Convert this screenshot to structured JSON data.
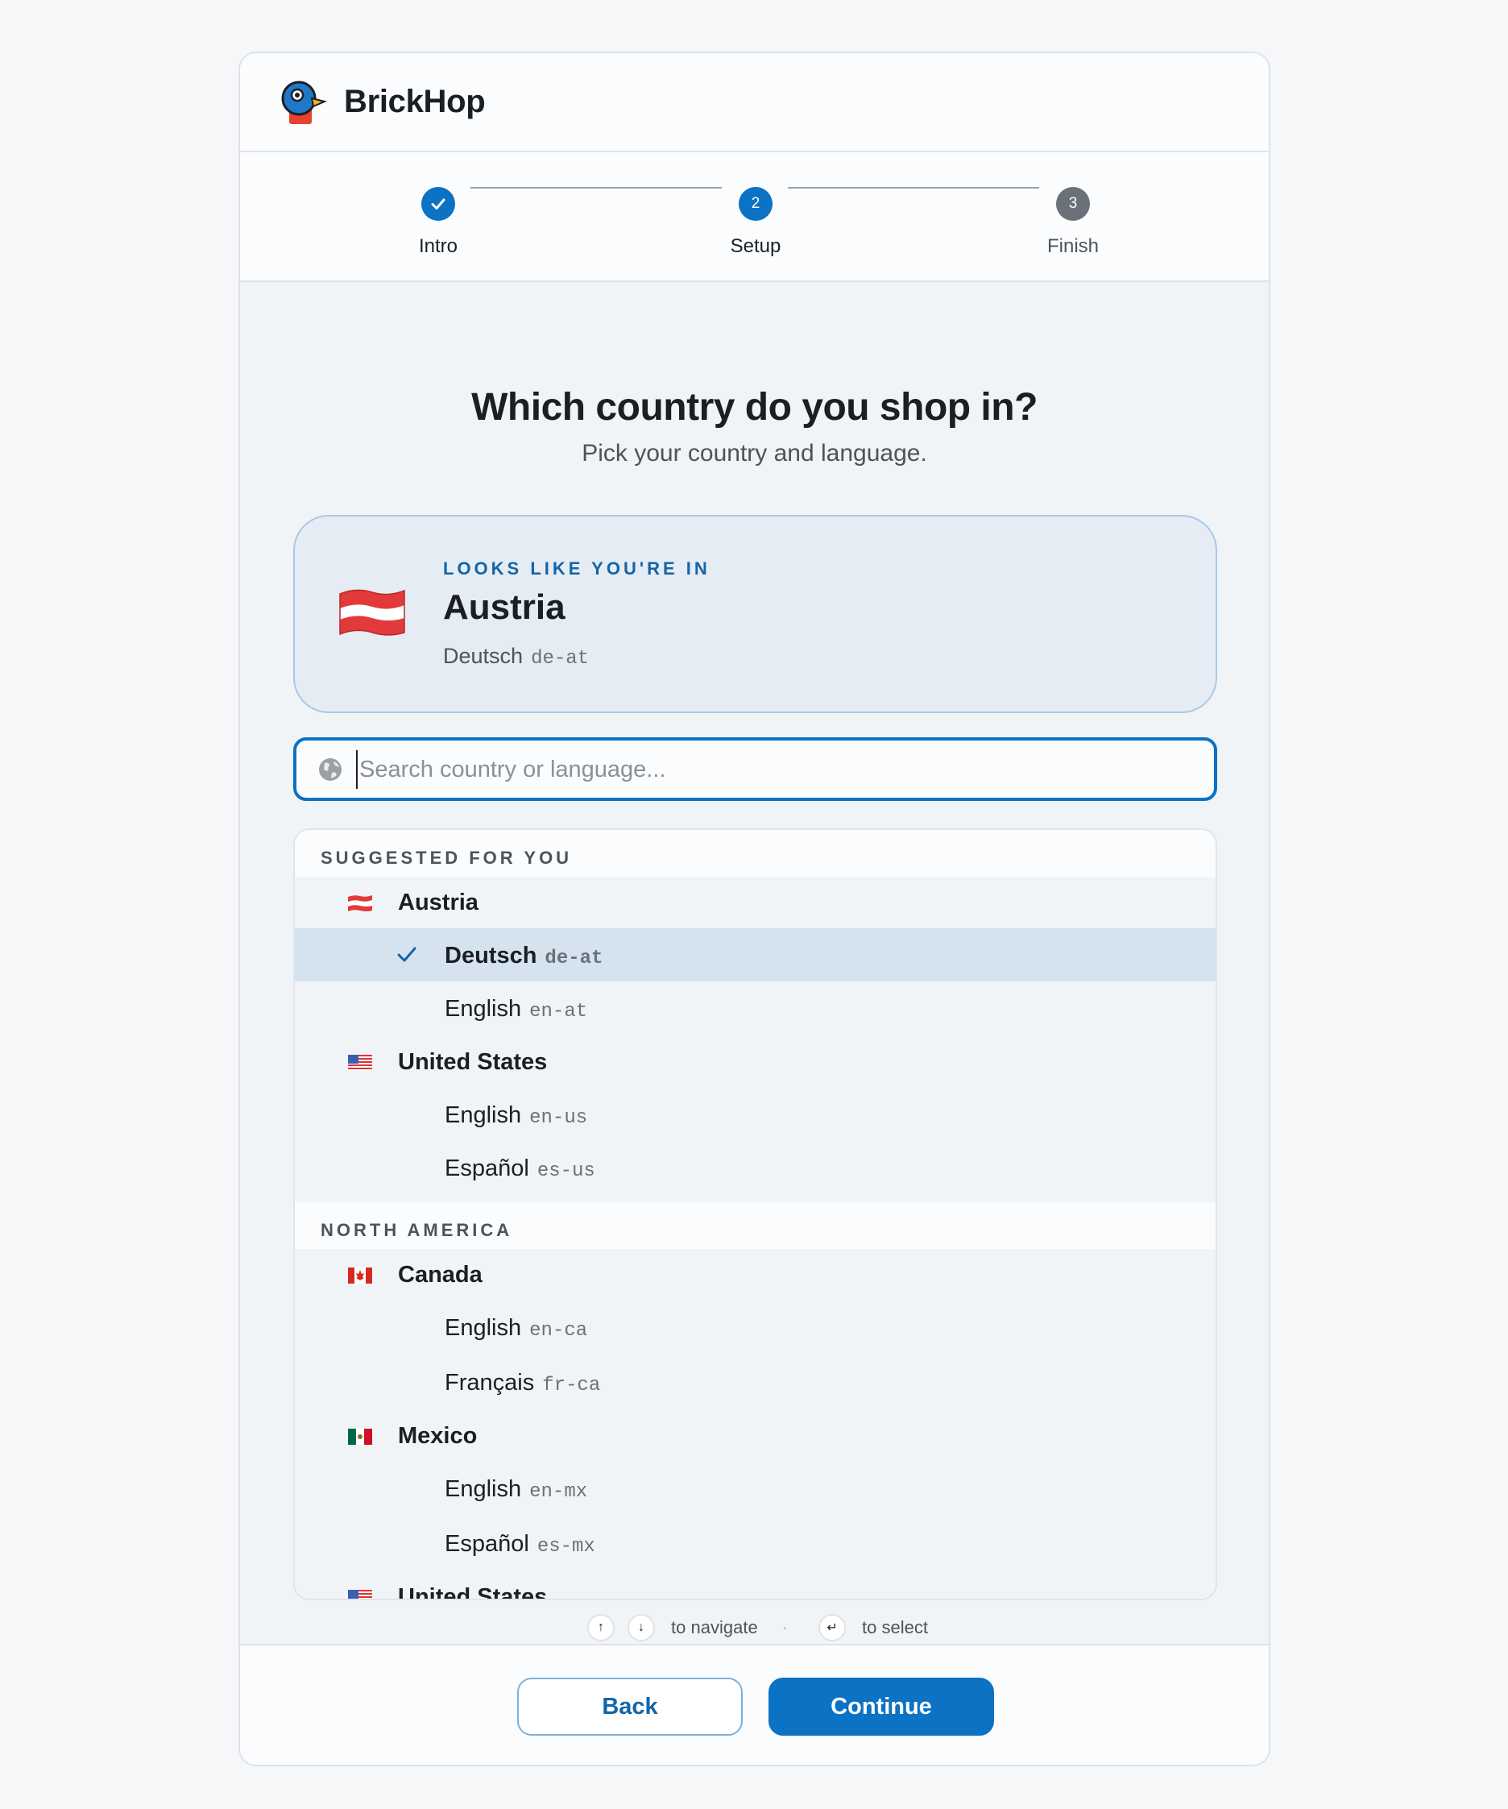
{
  "brand": {
    "name": "BrickHop",
    "logo_icon": "duck-logo-icon"
  },
  "stepper": {
    "steps": [
      {
        "label": "Intro",
        "state": "done",
        "number": "1"
      },
      {
        "label": "Setup",
        "state": "active",
        "number": "2"
      },
      {
        "label": "Finish",
        "state": "todo",
        "number": "3"
      }
    ]
  },
  "page": {
    "title": "Which country do you shop in?",
    "subtitle": "Pick your country and language."
  },
  "detected": {
    "kicker": "LOOKS LIKE YOU'RE IN",
    "country": "Austria",
    "language": "Deutsch",
    "code": "de-at",
    "flag_icon": "austria-flag-icon"
  },
  "search": {
    "placeholder": "Search country or language...",
    "value": "",
    "icon": "globe-icon"
  },
  "list": {
    "groups": [
      {
        "heading": "SUGGESTED FOR YOU",
        "countries": [
          {
            "name": "Austria",
            "flag": "austria-flag-icon",
            "languages": [
              {
                "name": "Deutsch",
                "code": "de-at",
                "selected": true
              },
              {
                "name": "English",
                "code": "en-at",
                "selected": false
              }
            ]
          },
          {
            "name": "United States",
            "flag": "us-flag-icon",
            "languages": [
              {
                "name": "English",
                "code": "en-us",
                "selected": false
              },
              {
                "name": "Español",
                "code": "es-us",
                "selected": false
              }
            ]
          }
        ]
      },
      {
        "heading": "NORTH AMERICA",
        "countries": [
          {
            "name": "Canada",
            "flag": "canada-flag-icon",
            "languages": [
              {
                "name": "English",
                "code": "en-ca",
                "selected": false
              },
              {
                "name": "Français",
                "code": "fr-ca",
                "selected": false
              }
            ]
          },
          {
            "name": "Mexico",
            "flag": "mexico-flag-icon",
            "languages": [
              {
                "name": "English",
                "code": "en-mx",
                "selected": false
              },
              {
                "name": "Español",
                "code": "es-mx",
                "selected": false
              }
            ]
          },
          {
            "name": "United States",
            "flag": "us-flag-icon",
            "languages": []
          }
        ]
      }
    ]
  },
  "hint": {
    "up_key": "↑",
    "down_key": "↓",
    "navigate": "to navigate",
    "separator": "·",
    "enter_key": "↵",
    "select": "to select"
  },
  "footer": {
    "back_label": "Back",
    "continue_label": "Continue"
  },
  "colors": {
    "accent": "#0b72c4",
    "selected_row": "#d5e3ef",
    "detected_bg": "#e5ecf3"
  }
}
